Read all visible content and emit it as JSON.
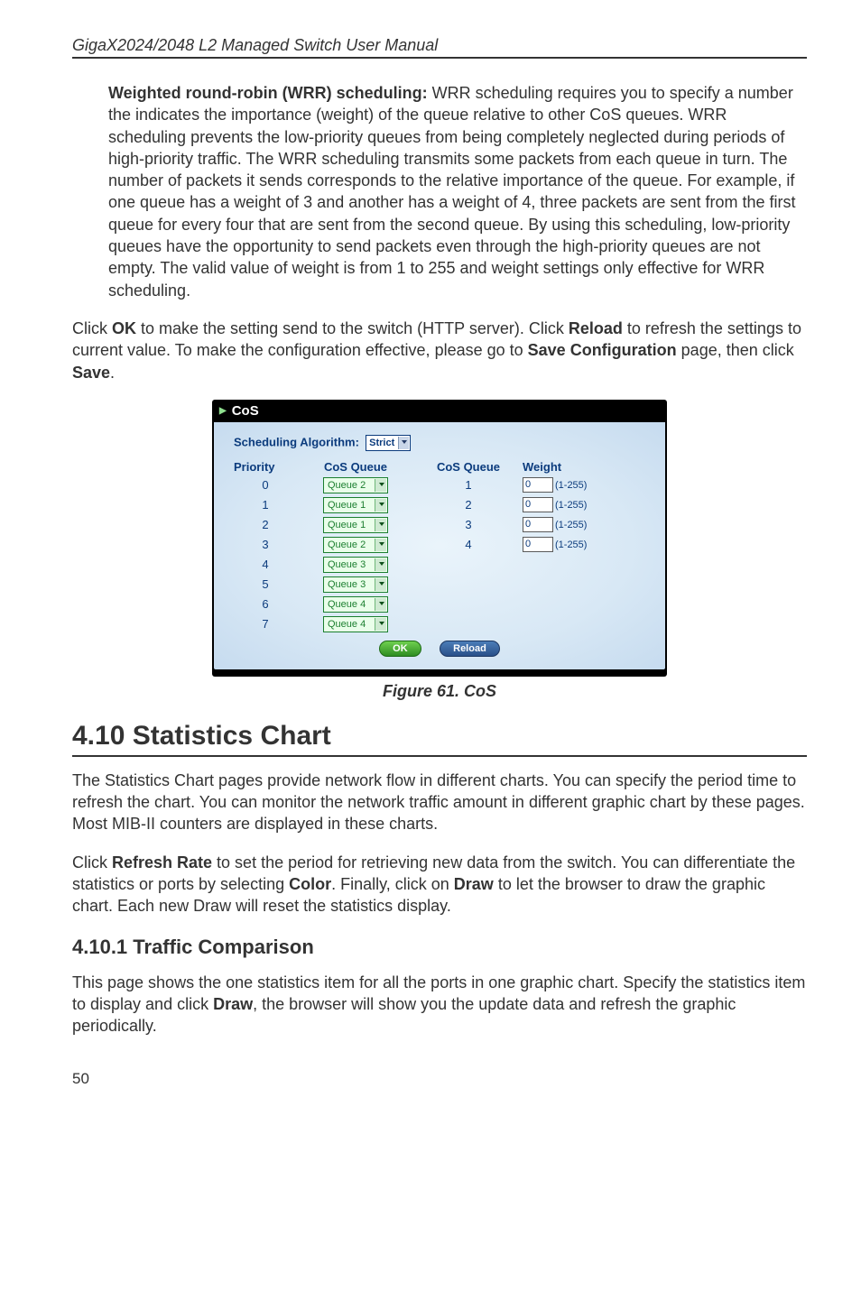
{
  "doc_header": "GigaX2024/2048 L2 Managed Switch User Manual",
  "wrr_para": {
    "lead_bold": "Weighted round-robin (WRR) scheduling:",
    "text": " WRR scheduling requires you to specify a number the indicates the importance (weight) of the queue relative to other CoS queues. WRR scheduling prevents the low-priority queues from being completely neglected during periods of high-priority traffic. The WRR scheduling transmits some packets from each queue in turn. The number of packets it sends corresponds to the relative importance of the queue. For example, if one queue has a weight of 3 and another has a weight of 4, three packets are sent from the first queue for every four that are sent from the second queue. By using this scheduling, low-priority queues have the opportunity to send packets even through the high-priority queues are not empty. The valid value of weight is from 1 to 255 and weight settings only effective for WRR scheduling."
  },
  "click_ok_para": {
    "p1": "Click ",
    "b1": "OK",
    "p2": " to make the setting send to the switch (HTTP server). Click ",
    "b2": "Reload",
    "p3": " to refresh the settings to current value. To make the configuration effective, please go to ",
    "b3": "Save Configuration",
    "p4": " page, then click ",
    "b4": "Save",
    "p5": "."
  },
  "cos_panel": {
    "title": "CoS",
    "sched_label": "Scheduling Algorithm:",
    "sched_value": "Strict",
    "headers": {
      "priority": "Priority",
      "queue_assign": "CoS Queue",
      "queue_group": "CoS Queue",
      "weight": "Weight"
    },
    "rows": [
      {
        "priority": "0",
        "queue": "Queue 2"
      },
      {
        "priority": "1",
        "queue": "Queue 1"
      },
      {
        "priority": "2",
        "queue": "Queue 1"
      },
      {
        "priority": "3",
        "queue": "Queue 2"
      },
      {
        "priority": "4",
        "queue": "Queue 3"
      },
      {
        "priority": "5",
        "queue": "Queue 3"
      },
      {
        "priority": "6",
        "queue": "Queue 4"
      },
      {
        "priority": "7",
        "queue": "Queue 4"
      }
    ],
    "weight_rows": [
      {
        "num": "1",
        "val": "0",
        "range": "(1-255)"
      },
      {
        "num": "2",
        "val": "0",
        "range": "(1-255)"
      },
      {
        "num": "3",
        "val": "0",
        "range": "(1-255)"
      },
      {
        "num": "4",
        "val": "0",
        "range": "(1-255)"
      }
    ],
    "ok_btn": "OK",
    "reload_btn": "Reload"
  },
  "figure_caption": "Figure 61. CoS",
  "section_4_10": "4.10 Statistics Chart",
  "stats_para1": "The Statistics Chart pages provide network flow in different charts. You can specify the period time to refresh the chart. You can monitor the network traffic amount in different graphic chart by these pages. Most MIB-II counters are displayed in these charts.",
  "stats_para2": {
    "p1": "Click ",
    "b1": "Refresh Rate",
    "p2": " to set the period for retrieving new data from the switch. You can differentiate the statistics or ports by selecting ",
    "b2": "Color",
    "p3": ". Finally, click on ",
    "b3": "Draw",
    "p4": " to let the browser to draw the graphic chart. Each new Draw will reset the statistics display."
  },
  "subsection_4_10_1": "4.10.1 Traffic Comparison",
  "traffic_para": {
    "p1": "This page shows the one statistics item for all the ports in one graphic chart. Specify the statistics item to display and click ",
    "b1": "Draw",
    "p2": ", the browser will show you the update data and refresh the graphic periodically."
  },
  "page_num": "50"
}
